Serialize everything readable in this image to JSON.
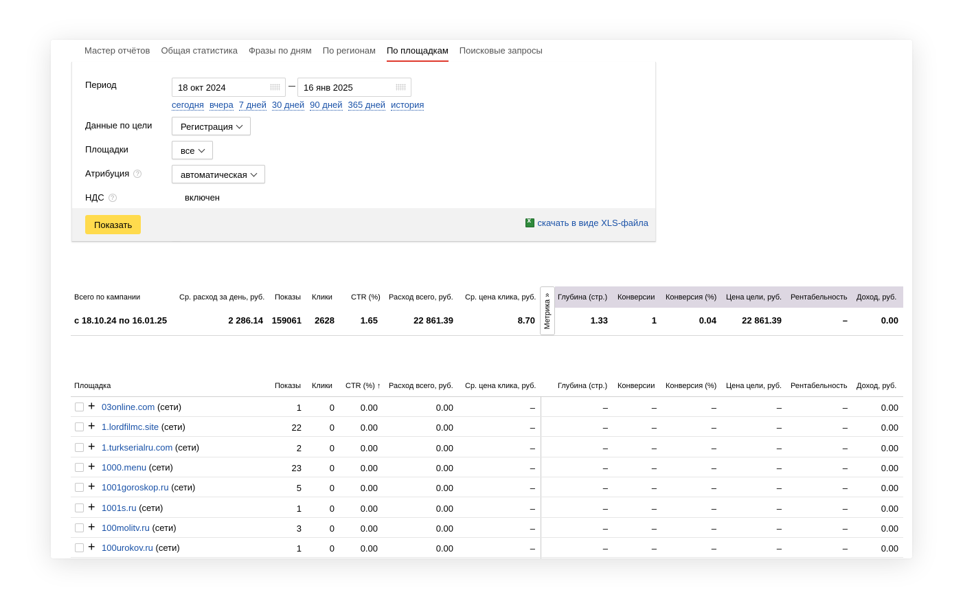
{
  "tabs": [
    "Мастер отчётов",
    "Общая статистика",
    "Фразы по дням",
    "По регионам",
    "По площадкам",
    "Поисковые запросы"
  ],
  "active_tab_index": 4,
  "form": {
    "period_label": "Период",
    "date_from": "18 окт 2024",
    "date_to": "16 янв 2025",
    "quick_ranges": [
      "сегодня",
      "вчера",
      "7 дней",
      "30 дней",
      "90 дней",
      "365 дней",
      "история"
    ],
    "goal_label": "Данные по цели",
    "goal_value": "Регистрация",
    "sites_label": "Площадки",
    "sites_value": "все",
    "attribution_label": "Атрибуция",
    "attribution_value": "автоматическая",
    "vat_label": "НДС",
    "vat_checkbox_label": "включен",
    "vat_checked": false,
    "help_glyph": "?",
    "show_button": "Показать",
    "xls_link": "скачать в виде XLS-файла"
  },
  "summary": {
    "headers": [
      "Всего по кампании",
      "Ср. расход за день, руб.",
      "Показы",
      "Клики",
      "CTR (%)",
      "Расход всего, руб.",
      "Ср. цена клика, руб.",
      "Глубина (стр.)",
      "Конверсии",
      "Конверсия (%)",
      "Цена цели, руб.",
      "Рентабельность",
      "Доход, руб."
    ],
    "values": [
      "с 18.10.24 по 16.01.25",
      "2 286.14",
      "159061",
      "2628",
      "1.65",
      "22 861.39",
      "8.70",
      "1.33",
      "1",
      "0.04",
      "22 861.39",
      "–",
      "0.00"
    ],
    "metrika_label": "Метрика »"
  },
  "detail": {
    "headers": [
      "Площадка",
      "Показы",
      "Клики",
      "CTR (%) ↑",
      "Расход всего, руб.",
      "Ср. цена клика, руб.",
      "Глубина (стр.)",
      "Конверсии",
      "Конверсия (%)",
      "Цена цели, руб.",
      "Рентабельность",
      "Доход, руб."
    ],
    "expand_glyph": "+",
    "rows": [
      {
        "site": "03online.com",
        "suffix": " (сети)",
        "values": [
          "1",
          "0",
          "0.00",
          "0.00",
          "–",
          "–",
          "–",
          "–",
          "–",
          "–",
          "0.00"
        ]
      },
      {
        "site": "1.lordfilmc.site",
        "suffix": " (сети)",
        "values": [
          "22",
          "0",
          "0.00",
          "0.00",
          "–",
          "–",
          "–",
          "–",
          "–",
          "–",
          "0.00"
        ]
      },
      {
        "site": "1.turkserialru.com",
        "suffix": " (сети)",
        "values": [
          "2",
          "0",
          "0.00",
          "0.00",
          "–",
          "–",
          "–",
          "–",
          "–",
          "–",
          "0.00"
        ]
      },
      {
        "site": "1000.menu",
        "suffix": " (сети)",
        "values": [
          "23",
          "0",
          "0.00",
          "0.00",
          "–",
          "–",
          "–",
          "–",
          "–",
          "–",
          "0.00"
        ]
      },
      {
        "site": "1001goroskop.ru",
        "suffix": " (сети)",
        "values": [
          "5",
          "0",
          "0.00",
          "0.00",
          "–",
          "–",
          "–",
          "–",
          "–",
          "–",
          "0.00"
        ]
      },
      {
        "site": "1001s.ru",
        "suffix": " (сети)",
        "values": [
          "1",
          "0",
          "0.00",
          "0.00",
          "–",
          "–",
          "–",
          "–",
          "–",
          "–",
          "0.00"
        ]
      },
      {
        "site": "100molitv.ru",
        "suffix": " (сети)",
        "values": [
          "3",
          "0",
          "0.00",
          "0.00",
          "–",
          "–",
          "–",
          "–",
          "–",
          "–",
          "0.00"
        ]
      },
      {
        "site": "100urokov.ru",
        "suffix": " (сети)",
        "values": [
          "1",
          "0",
          "0.00",
          "0.00",
          "–",
          "–",
          "–",
          "–",
          "–",
          "–",
          "0.00"
        ]
      }
    ]
  }
}
